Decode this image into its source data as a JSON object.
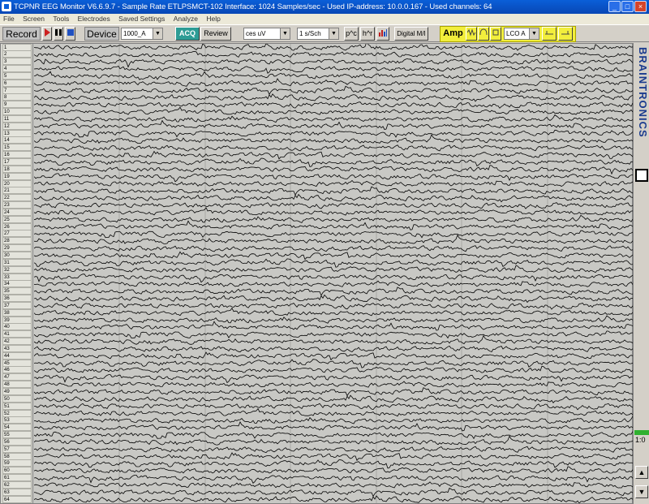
{
  "window": {
    "title": "TCPNR EEG Monitor V6.6.9.7 - Sample Rate ETLPSMCT-102 Interface: 1024 Samples/sec - Used IP-address: 10.0.0.167 - Used channels: 64",
    "minimize": "_",
    "maximize": "□",
    "close": "×"
  },
  "menu": [
    "File",
    "Screen",
    "Tools",
    "Electrodes",
    "Saved Settings",
    "Analyze",
    "Help"
  ],
  "toolbar": {
    "record_label": "Record",
    "device_label": "Device",
    "device_value": "1000_A",
    "acq_label": "ACQ",
    "review_label": "Review",
    "sensitivity_value": "ces uV",
    "timebase_value": "1 s/Sch",
    "btn_p_up": "p^c",
    "btn_h_up": "h^r",
    "digital_label": "Digital M/I",
    "amp_label": "Amp",
    "amp_select": "LCO A"
  },
  "colors": {
    "record_play": "#cc2020",
    "stop": "#2050c0",
    "brand": "#1a3b8e",
    "trace": "#000000",
    "accent_green": "#2fb02f",
    "amp_bg": "#f2ee3c"
  },
  "channels": [
    "1",
    "2",
    "3",
    "4",
    "5",
    "6",
    "7",
    "8",
    "9",
    "10",
    "11",
    "12",
    "13",
    "14",
    "15",
    "16",
    "17",
    "18",
    "19",
    "20",
    "21",
    "22",
    "23",
    "24",
    "25",
    "26",
    "27",
    "28",
    "29",
    "30",
    "31",
    "32",
    "33",
    "34",
    "35",
    "36",
    "37",
    "38",
    "39",
    "40",
    "41",
    "42",
    "43",
    "44",
    "45",
    "46",
    "47",
    "48",
    "49",
    "50",
    "51",
    "52",
    "53",
    "54",
    "55",
    "56",
    "57",
    "58",
    "59",
    "60",
    "61",
    "62",
    "63",
    "64"
  ],
  "sidebar": {
    "brand": "BRAINTRONICS",
    "ratio": "1:0",
    "scroll_up": "▲",
    "scroll_down": "▼"
  }
}
